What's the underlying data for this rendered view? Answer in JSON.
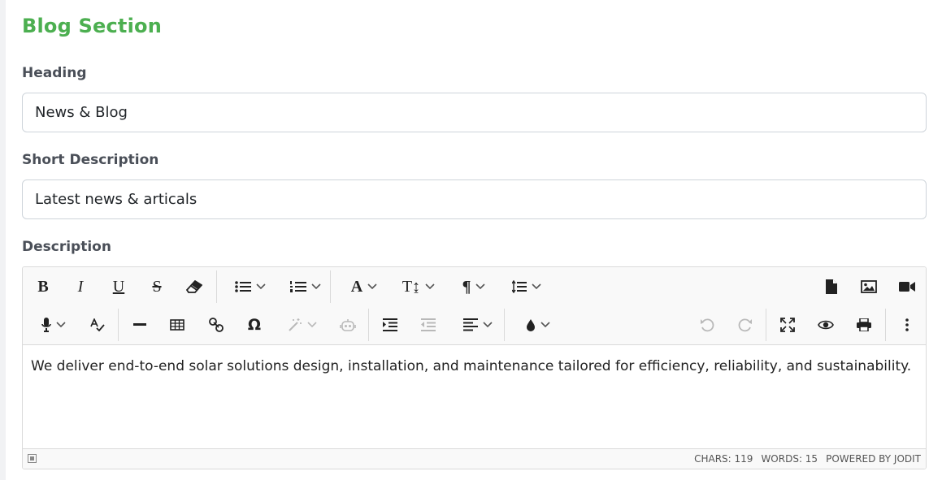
{
  "section": {
    "title": "Blog Section"
  },
  "fields": {
    "heading": {
      "label": "Heading",
      "value": "News & Blog"
    },
    "short_description": {
      "label": "Short Description",
      "value": "Latest news & articals"
    },
    "description": {
      "label": "Description"
    }
  },
  "editor": {
    "content": "We deliver end-to-end solar solutions design, installation, and maintenance tailored for efficiency, reliability, and sustainability.",
    "status": {
      "chars": "CHARS: 119",
      "words": "WORDS: 15",
      "powered_by": "POWERED BY JODIT"
    },
    "toolbar": {
      "bold": "B",
      "italic": "I",
      "underline": "U",
      "strikethrough": "S",
      "font": "A",
      "font_size": "T↨",
      "paragraph": "¶",
      "special_char": "Ω"
    },
    "icons": [
      "bold-icon",
      "italic-icon",
      "underline-icon",
      "strikethrough-icon",
      "eraser-icon",
      "bulleted-list-icon",
      "numbered-list-icon",
      "font-icon",
      "font-size-icon",
      "paragraph-icon",
      "line-height-icon",
      "file-icon",
      "image-icon",
      "video-icon",
      "microphone-icon",
      "spellcheck-icon",
      "horizontal-rule-icon",
      "table-icon",
      "link-icon",
      "omega-icon",
      "magic-wand-icon",
      "robot-icon",
      "indent-icon",
      "outdent-icon",
      "align-left-icon",
      "color-drop-icon",
      "undo-icon",
      "redo-icon",
      "fullscreen-icon",
      "eye-icon",
      "print-icon",
      "more-vertical-icon"
    ],
    "colors": {
      "accent": "#4caf50",
      "toolbar_bg": "#f9f9f9",
      "border": "#dadada"
    }
  }
}
